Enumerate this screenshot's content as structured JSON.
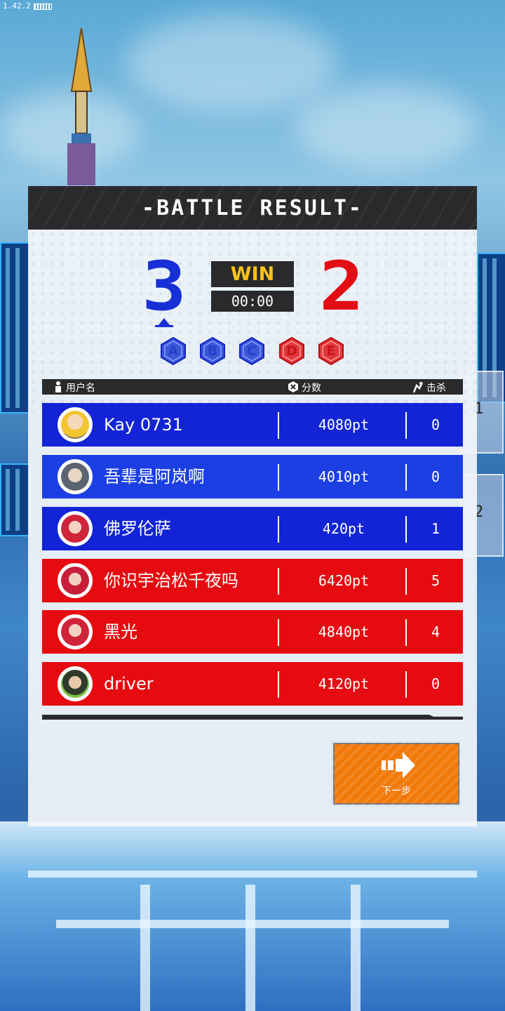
{
  "version": "1.42.2",
  "panel": {
    "title": "-BATTLE RESULT-"
  },
  "score": {
    "blue": "3",
    "red": "2",
    "result": "WIN",
    "time": "00:00",
    "blue_color": "#1730d6",
    "red_color": "#e30d14"
  },
  "zones": [
    {
      "letter": "A",
      "team": "blue"
    },
    {
      "letter": "B",
      "team": "blue"
    },
    {
      "letter": "C",
      "team": "blue"
    },
    {
      "letter": "D",
      "team": "red"
    },
    {
      "letter": "E",
      "team": "red"
    }
  ],
  "table": {
    "col_name": "用户名",
    "col_score": "分数",
    "col_kills": "击杀",
    "rows": [
      {
        "name": "Kay 0731",
        "points": "4080pt",
        "kills": "0",
        "team": "blue"
      },
      {
        "name": "吾辈是阿岚啊",
        "points": "4010pt",
        "kills": "0",
        "team": "blue"
      },
      {
        "name": "佛罗伦萨",
        "points": "420pt",
        "kills": "1",
        "team": "blue"
      },
      {
        "name": "你识宇治松千夜吗",
        "points": "6420pt",
        "kills": "5",
        "team": "red"
      },
      {
        "name": "黑光",
        "points": "4840pt",
        "kills": "4",
        "team": "red"
      },
      {
        "name": "driver",
        "points": "4120pt",
        "kills": "0",
        "team": "red"
      }
    ]
  },
  "next_button": {
    "label": "下一步",
    "icon": "arrow-right-icon",
    "color": "#f27a0a"
  },
  "side_tabs": [
    "1",
    "2"
  ]
}
